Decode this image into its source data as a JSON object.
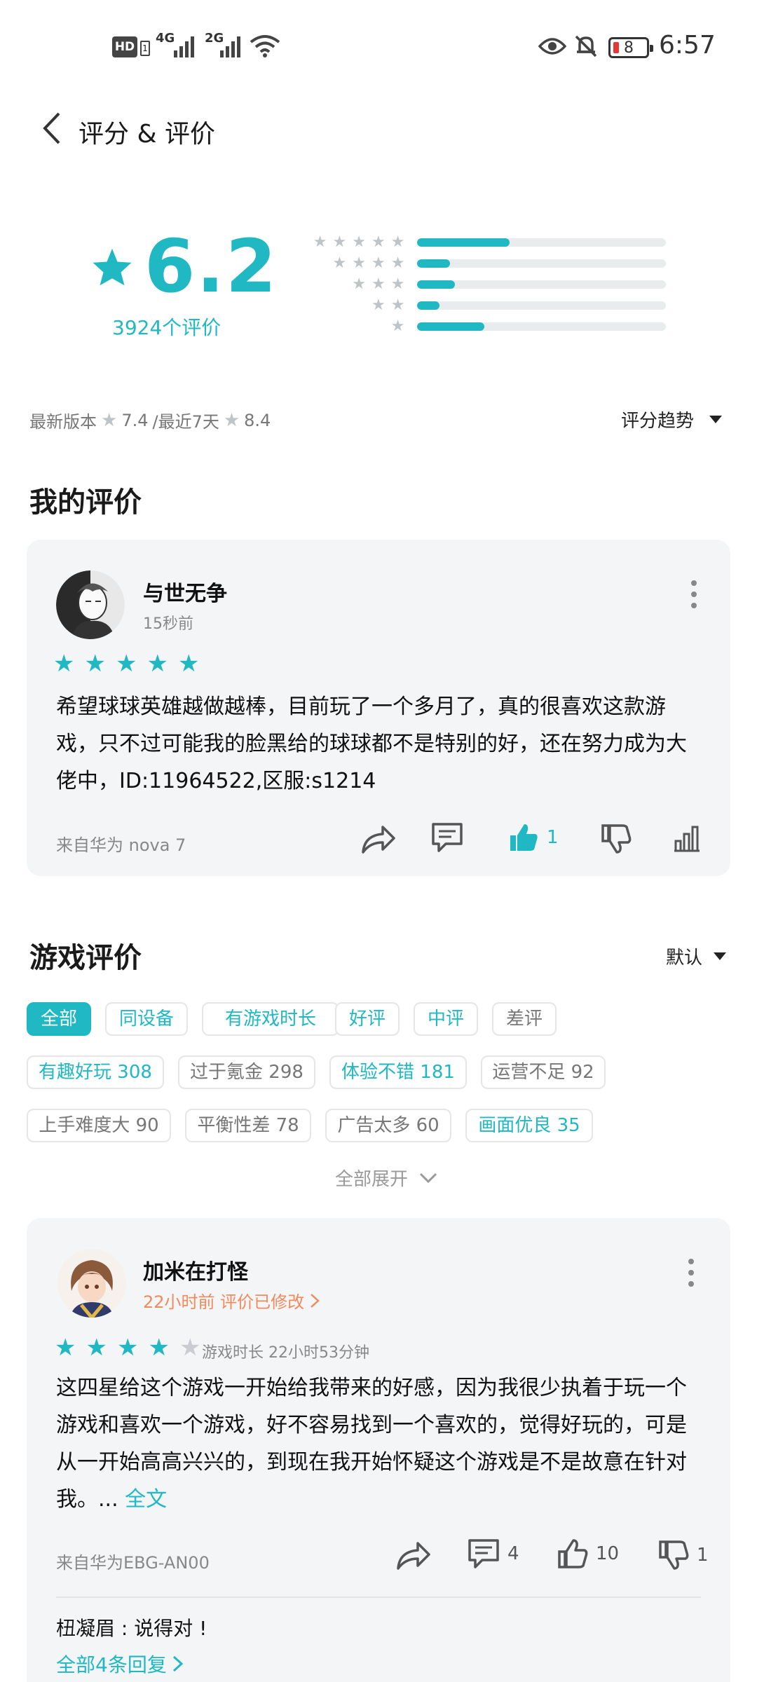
{
  "status_bar": {
    "left_icons": [
      "HD",
      "4G",
      "2G",
      "wifi"
    ],
    "battery": "8",
    "time": "6:57"
  },
  "header": {
    "title": "评分 & 评价"
  },
  "rating": {
    "score": "6.2",
    "count_label": "3924个评价",
    "distribution": [
      {
        "stars": 5,
        "fraction": 0.37
      },
      {
        "stars": 4,
        "fraction": 0.13
      },
      {
        "stars": 3,
        "fraction": 0.15
      },
      {
        "stars": 2,
        "fraction": 0.09
      },
      {
        "stars": 1,
        "fraction": 0.27
      }
    ],
    "latest_version_label": "最新版本",
    "latest_version_score": "7.4",
    "recent_label": "/最近7天",
    "recent_score": "8.4",
    "trend_label": "评分趋势"
  },
  "my_review": {
    "section_title": "我的评价",
    "user": "与世无争",
    "time": "15秒前",
    "stars": 5,
    "text": "希望球球英雄越做越棒，目前玩了一个多月了，真的很喜欢这款游戏，只不过可能我的脸黑给的球球都不是特别的好，还在努力成为大佬中，ID:11964522,区服:s1214",
    "device": "来自华为 nova 7",
    "like_count": "1"
  },
  "game_reviews": {
    "section_title": "游戏评价",
    "sort_label": "默认",
    "chips": [
      {
        "label": "全部",
        "style": "active"
      },
      {
        "label": "同设备",
        "style": "teal"
      },
      {
        "label": "有游戏时长",
        "style": "teal"
      },
      {
        "label": "好评",
        "style": "teal"
      },
      {
        "label": "中评",
        "style": "teal"
      },
      {
        "label": "差评",
        "style": "gray"
      },
      {
        "label": "有趣好玩 308",
        "style": "teal"
      },
      {
        "label": "过于氪金 298",
        "style": "gray"
      },
      {
        "label": "体验不错 181",
        "style": "teal"
      },
      {
        "label": "运营不足 92",
        "style": "gray"
      },
      {
        "label": "上手难度大 90",
        "style": "gray"
      },
      {
        "label": "平衡性差 78",
        "style": "gray"
      },
      {
        "label": "广告太多 60",
        "style": "gray"
      },
      {
        "label": "画面优良 35",
        "style": "teal"
      }
    ],
    "expand_label": "全部展开"
  },
  "review2": {
    "user": "加米在打怪",
    "time_note": "22小时前 评价已修改",
    "stars": 4,
    "playtime": "游戏时长 22小时53分钟",
    "text": "这四星给这个游戏一开始给我带来的好感，因为我很少执着于玩一个游戏和喜欢一个游戏，好不容易找到一个喜欢的，觉得好玩的，可是从一开始高高兴兴的，到现在我开始怀疑这个游戏是不是故意在针对我。...",
    "more_label": "全文",
    "device": "来自华为EBG-AN00",
    "comment_count": "4",
    "like_count": "10",
    "dislike_count": "1",
    "reply_preview": "杻凝眉 : 说得对 !",
    "all_replies_label": "全部4条回复"
  },
  "colors": {
    "accent": "#1fb8c3",
    "orange": "#f08a5d",
    "card_bg": "#f4f5f7"
  }
}
